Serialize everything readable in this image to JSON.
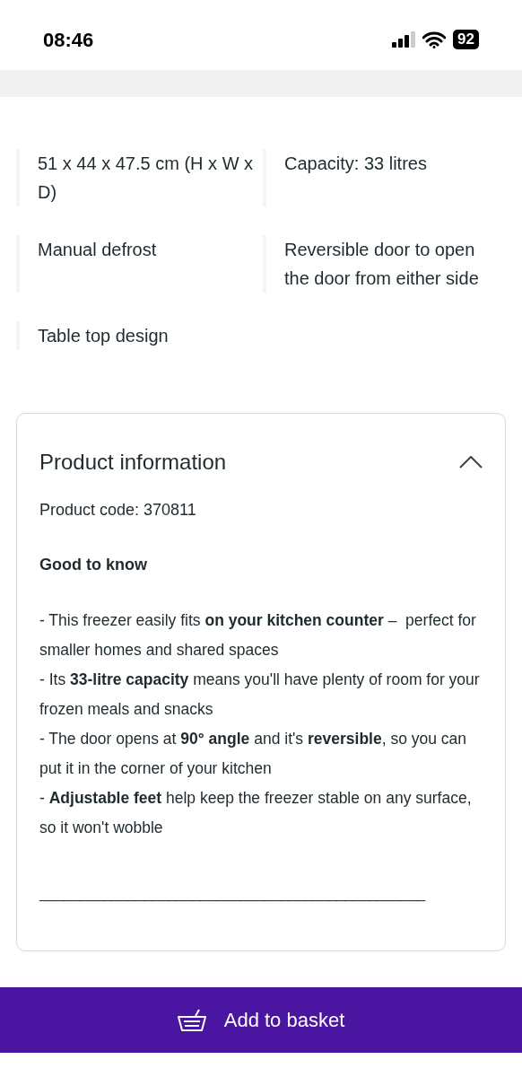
{
  "status_bar": {
    "time": "08:46",
    "battery": "92"
  },
  "features": [
    {
      "text": "51 x 44 x 47.5 cm (H x W x D)"
    },
    {
      "text": "Capacity: 33 litres"
    },
    {
      "text": "Manual defrost"
    },
    {
      "text": "Reversible door to open the door from either side"
    },
    {
      "text": "Table top design"
    }
  ],
  "product_information": {
    "title": "Product information",
    "expanded": true,
    "product_code": "Product code: 370811",
    "heading": "Good to know",
    "bullets": [
      "- This freezer easily fits **on your kitchen counter** –  perfect for smaller homes and shared spaces",
      "- Its **33-litre capacity** means you'll have plenty of room for your frozen meals and snacks",
      "- The door opens at **90° angle** and it's **reversible**, so you can put it in the corner of your kitchen",
      "- **Adjustable feet** help keep the freezer stable on any surface, so it won't wobble"
    ],
    "separator": "________________________________________________"
  },
  "add_to_basket": {
    "label": "Add to basket"
  }
}
